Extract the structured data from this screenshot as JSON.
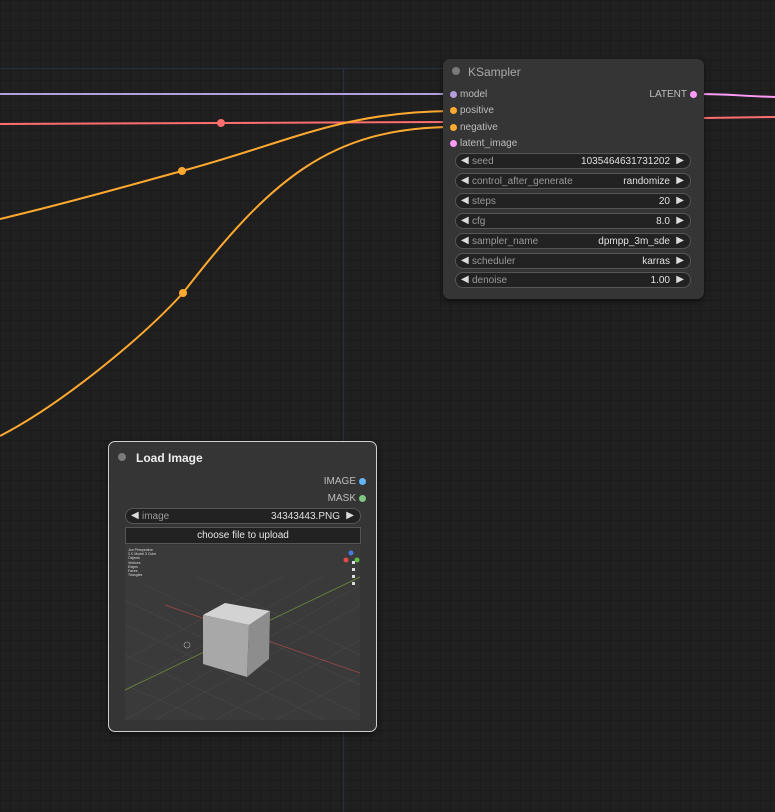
{
  "ksampler": {
    "title": "KSampler",
    "inputs": [
      "model",
      "positive",
      "negative",
      "latent_image"
    ],
    "output": "LATENT",
    "widgets": [
      {
        "name": "seed",
        "value": "1035464631731202"
      },
      {
        "name": "control_after_generate",
        "value": "randomize"
      },
      {
        "name": "steps",
        "value": "20"
      },
      {
        "name": "cfg",
        "value": "8.0"
      },
      {
        "name": "sampler_name",
        "value": "dpmpp_3m_sde"
      },
      {
        "name": "scheduler",
        "value": "karras"
      },
      {
        "name": "denoise",
        "value": "1.00"
      }
    ]
  },
  "load_image": {
    "title": "Load Image",
    "outputs": [
      "IMAGE",
      "MASK"
    ],
    "image_widget": {
      "name": "image",
      "value": "34343443.PNG"
    },
    "upload_label": "choose file to upload",
    "preview_text": [
      "Jon Perspective",
      "3 C Model 3 Cube",
      "Objects",
      "Vertices",
      "Edges",
      "Faces",
      "Triangles"
    ]
  },
  "arrows": {
    "left": "◀",
    "right": "▶"
  },
  "colors": {
    "model_link": "#b39ddb",
    "conditioning_link": "#ffa931",
    "clip_link": "#ff6e6e",
    "latent_link": "#ff9cf9",
    "image_slot": "#64b5f6",
    "mask_slot": "#81c784"
  }
}
